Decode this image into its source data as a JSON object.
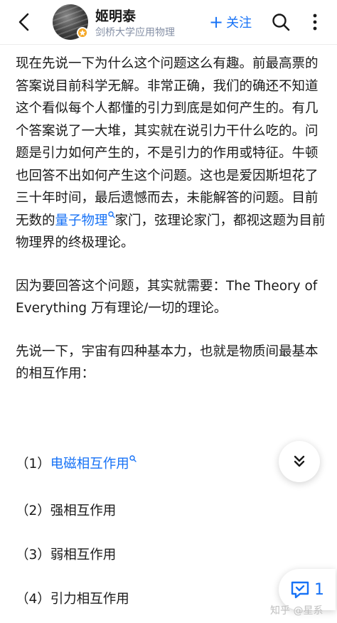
{
  "header": {
    "author_name": "姬明泰",
    "author_bio": "剑桥大学应用物理",
    "follow_label": "关注"
  },
  "content": {
    "paragraph_1": {
      "before_link": "现在先说一下为什么这个问题这么有趣。前最高票的答案说目前科学无解。非常正确，我们的确还不知道这个看似每个人都懂的引力到底是如何产生的。有几个答案说了一大堆，其实就在说引力干什么吃的。问题是引力如何产生的，不是引力的作用或特征。牛顿也回答不出如何产生这个问题。这也是爱因斯坦花了三十年时间，最后遗憾而去，未能解答的问题。目前无数的",
      "link_text": "量子物理",
      "after_link": "家门，弦理论家门，都视这题为目前物理界的终极理论。"
    },
    "paragraph_2": "因为要回答这个问题，其实就需要：The Theory of Everything 万有理论/一切的理论。",
    "paragraph_3": "先说一下，宇宙有四种基本力，也就是物质间最基本的相互作用：",
    "list": [
      {
        "prefix": "（1）",
        "text": "电磁相互作用",
        "is_link": true
      },
      {
        "prefix": "（2）",
        "text": "强相互作用",
        "is_link": false
      },
      {
        "prefix": "（3）",
        "text": "弱相互作用",
        "is_link": false
      },
      {
        "prefix": "（4）",
        "text": "引力相互作用",
        "is_link": false
      }
    ]
  },
  "floating": {
    "comment_count": "1"
  },
  "watermark": "知乎 @星系",
  "colors": {
    "accent": "#1772f6",
    "text": "#1a1a1a",
    "muted": "#8590a6",
    "badge": "#f5a623"
  },
  "icons": [
    "back-arrow-icon",
    "search-icon",
    "more-icon",
    "double-chevron-down-icon",
    "comment-icon",
    "search-link-icon",
    "verified-badge-icon"
  ]
}
